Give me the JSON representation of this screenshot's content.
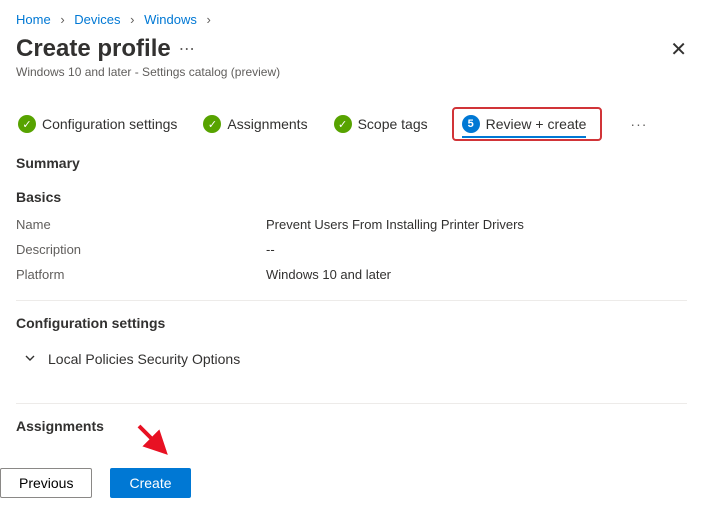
{
  "breadcrumb": {
    "home": "Home",
    "devices": "Devices",
    "windows": "Windows"
  },
  "page": {
    "title": "Create profile",
    "subtitle": "Windows 10 and later - Settings catalog (preview)"
  },
  "tabs": {
    "config": "Configuration settings",
    "assign": "Assignments",
    "scope": "Scope tags",
    "review_num": "5",
    "review": "Review + create"
  },
  "summary": {
    "label": "Summary",
    "basics_label": "Basics",
    "name_k": "Name",
    "name_v": "Prevent Users From Installing Printer Drivers",
    "desc_k": "Description",
    "desc_v": "--",
    "plat_k": "Platform",
    "plat_v": "Windows 10 and later",
    "config_label": "Configuration settings",
    "expander": "Local Policies Security Options",
    "assign_label": "Assignments"
  },
  "footer": {
    "prev": "Previous",
    "create": "Create"
  }
}
